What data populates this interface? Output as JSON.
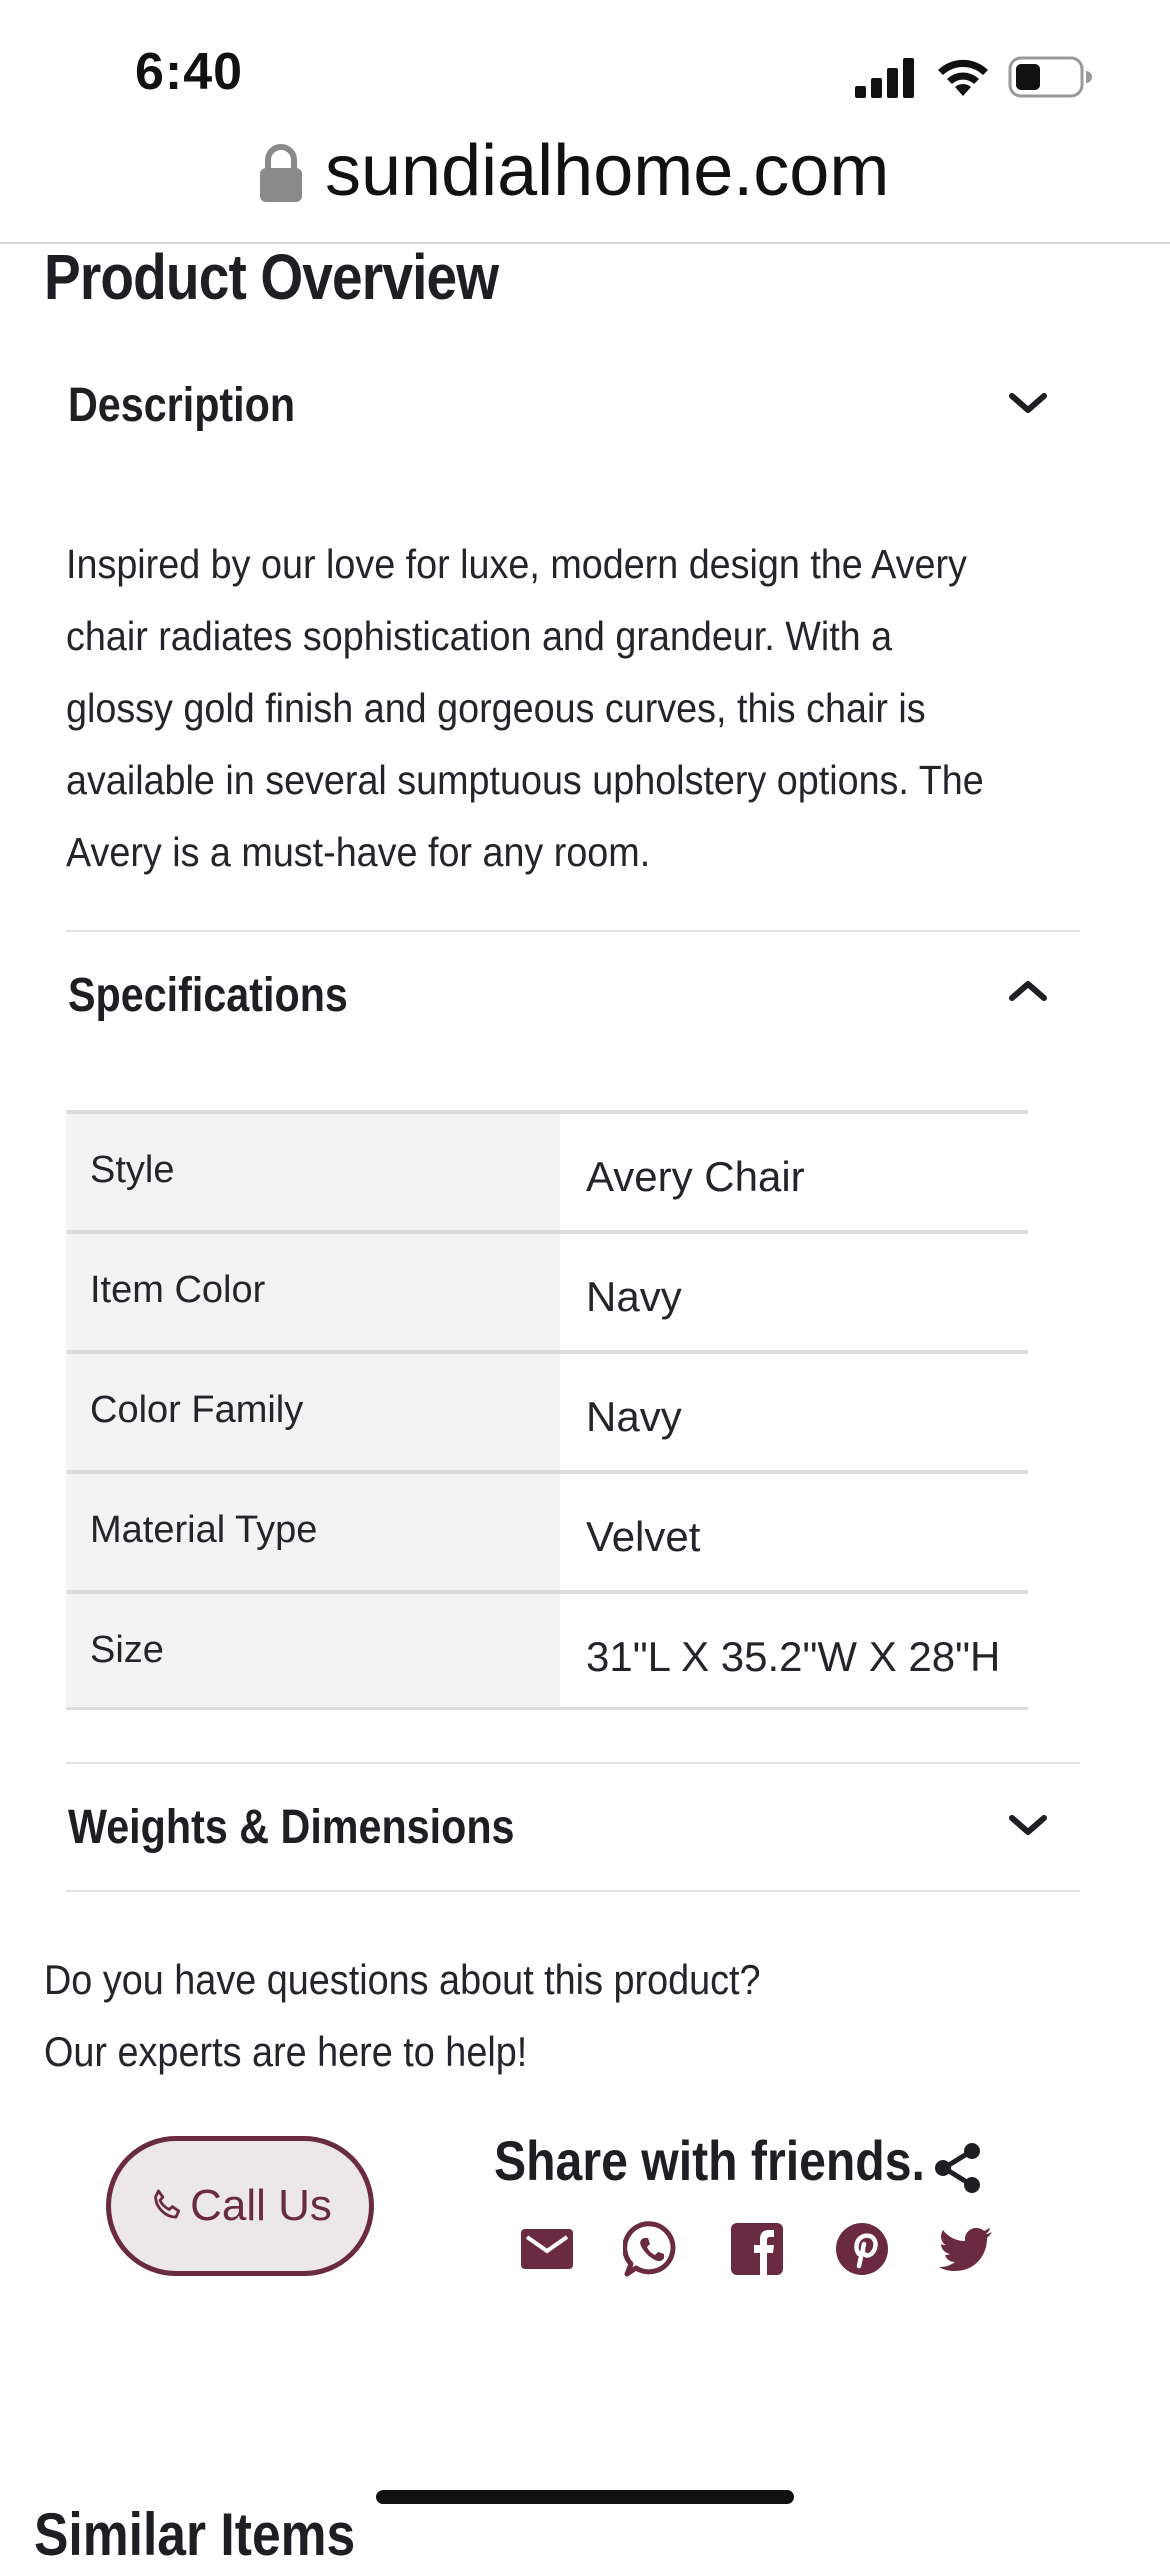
{
  "status_bar": {
    "time": "6:40"
  },
  "browser": {
    "url": "sundialhome.com"
  },
  "page": {
    "title": "Product Overview"
  },
  "description": {
    "heading": "Description",
    "text": "Inspired by our love for luxe, modern design the Avery chair radiates sophistication and grandeur. With a glossy gold finish and gorgeous curves, this chair is available in several sumptuous upholstery options. The Avery is a must-have for any room."
  },
  "specifications": {
    "heading": "Specifications",
    "rows": [
      {
        "key": "Style",
        "value": "Avery Chair"
      },
      {
        "key": "Item Color",
        "value": "Navy"
      },
      {
        "key": "Color Family",
        "value": "Navy"
      },
      {
        "key": "Material Type",
        "value": "Velvet"
      },
      {
        "key": "Size",
        "value": "31\"L X 35.2\"W X 28\"H"
      }
    ]
  },
  "weights": {
    "heading": "Weights & Dimensions"
  },
  "help": {
    "line1": "Do you have questions about this product?",
    "line2": "Our experts are here to help!"
  },
  "call": {
    "label": "Call Us"
  },
  "share": {
    "title": "Share with friends.",
    "icons": [
      "email-icon",
      "whatsapp-icon",
      "facebook-icon",
      "pinterest-icon",
      "twitter-icon"
    ]
  },
  "next_section": {
    "heading": "Similar Items"
  },
  "colors": {
    "accent": "#6a2a42",
    "text": "#1f1f23",
    "table_key_bg": "#f3f3f3"
  }
}
